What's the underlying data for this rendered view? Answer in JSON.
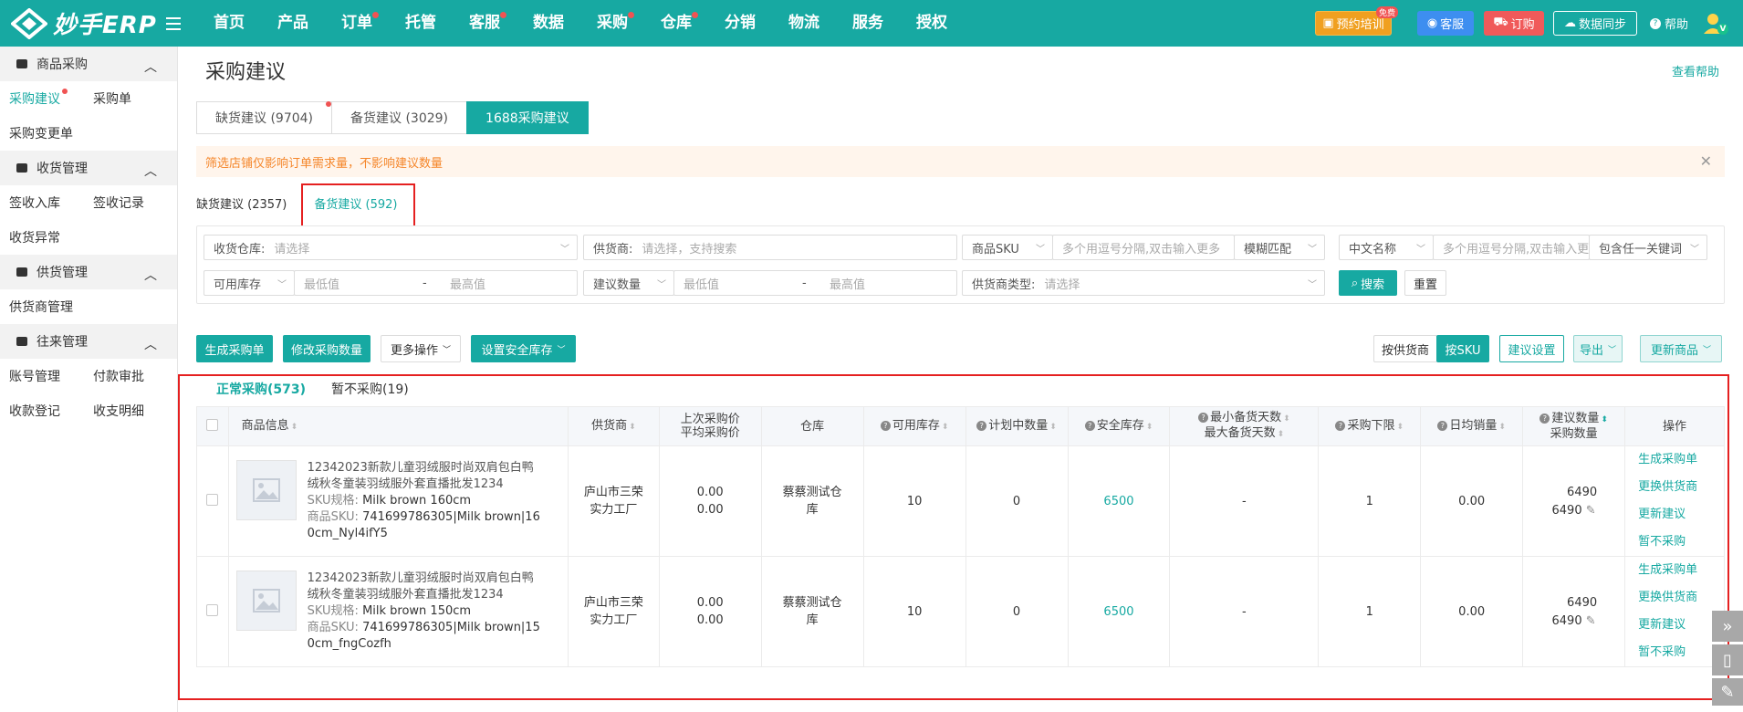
{
  "topbar": {
    "brand": "妙手ERP",
    "nav": [
      {
        "label": "首页",
        "dot": false
      },
      {
        "label": "产品",
        "dot": false
      },
      {
        "label": "订单",
        "dot": true
      },
      {
        "label": "托管",
        "dot": false
      },
      {
        "label": "客服",
        "dot": true
      },
      {
        "label": "数据",
        "dot": false
      },
      {
        "label": "采购",
        "dot": true
      },
      {
        "label": "仓库",
        "dot": true
      },
      {
        "label": "分销",
        "dot": false
      },
      {
        "label": "物流",
        "dot": false
      },
      {
        "label": "服务",
        "dot": false
      },
      {
        "label": "授权",
        "dot": false
      }
    ],
    "training": "预约培训",
    "training_badge": "免费",
    "service": "客服",
    "order": "订购",
    "sync": "数据同步",
    "help": "帮助",
    "avatar_letter": "V"
  },
  "sidebar": {
    "groups": [
      {
        "title": "商品采购",
        "rows": [
          [
            {
              "label": "采购建议",
              "active": true,
              "dot": true
            },
            {
              "label": "采购单"
            }
          ],
          [
            {
              "label": "采购变更单"
            }
          ]
        ]
      },
      {
        "title": "收货管理",
        "rows": [
          [
            {
              "label": "签收入库"
            },
            {
              "label": "签收记录"
            }
          ],
          [
            {
              "label": "收货异常"
            }
          ]
        ]
      },
      {
        "title": "供货管理",
        "rows": [
          [
            {
              "label": "供货商管理"
            }
          ]
        ]
      },
      {
        "title": "往来管理",
        "rows": [
          [
            {
              "label": "账号管理"
            },
            {
              "label": "付款审批"
            }
          ],
          [
            {
              "label": "收款登记"
            },
            {
              "label": "收支明细"
            }
          ]
        ]
      }
    ]
  },
  "page": {
    "title": "采购建议",
    "help_link": "查看帮助",
    "tabs": [
      "缺货建议 (9704)",
      "备货建议 (3029)",
      "1688采购建议"
    ],
    "notice": "筛选店铺仅影响订单需求量，不影响建议数量",
    "subtabs": [
      "缺货建议 (2357)",
      "备货建议 (592)"
    ]
  },
  "filters": {
    "warehouse_label": "收货仓库:",
    "warehouse_ph": "请选择",
    "supplier_label": "供货商:",
    "supplier_ph": "请选择，支持搜索",
    "sku_label": "商品SKU",
    "sku_ph": "多个用逗号分隔,双击输入更多",
    "match": "模糊匹配",
    "cn_name": "中文名称",
    "cn_ph": "多个用逗号分隔,双击输入更多",
    "kw_match": "包含任一关键词",
    "stock_label": "可用库存",
    "min_ph": "最低值",
    "max_ph": "最高值",
    "dash": "-",
    "qty_label": "建议数量",
    "min_ph2": "最低值",
    "max_ph2": "最高值",
    "dash2": "-",
    "stype_label": "供货商类型:",
    "stype_ph": "请选择",
    "search": "搜索",
    "reset": "重置"
  },
  "actions": {
    "create": "生成采购单",
    "modify": "修改采购数量",
    "more": "更多操作",
    "safety": "设置安全库存",
    "by_supplier": "按供货商",
    "by_sku": "按SKU",
    "settings": "建议设置",
    "export": "导出",
    "update": "更新商品"
  },
  "list": {
    "tabs": [
      "正常采购(573)",
      "暂不采购(19)"
    ],
    "headers": {
      "product": "商品信息",
      "supplier": "供货商",
      "price1": "上次采购价",
      "price2": "平均采购价",
      "warehouse": "仓库",
      "available": "可用库存",
      "planned": "计划中数量",
      "safety": "安全库存",
      "days1": "最小备货天数",
      "days2": "最大备货天数",
      "lower": "采购下限",
      "daily": "日均销量",
      "qty1": "建议数量",
      "qty2": "采购数量",
      "ops": "操作"
    },
    "rows": [
      {
        "title": "12342023新款儿童羽绒服时尚双肩包白鸭绒秋冬童装羽绒服外套直播批发1234",
        "spec_label": "SKU规格:",
        "spec": "Milk brown 160cm",
        "sku_label": "商品SKU:",
        "sku": "741699786305|Milk brown|160cm_Nyl4ifY5",
        "supplier": "庐山市三荣实力工厂",
        "last_price": "0.00",
        "avg_price": "0.00",
        "warehouse": "蔡蔡测试仓库",
        "available": "10",
        "planned": "0",
        "safety": "6500",
        "days": "-",
        "lower": "1",
        "daily": "0.00",
        "suggest": "6490",
        "purchase": "6490",
        "ops": [
          "生成采购单",
          "更换供货商",
          "更新建议",
          "暂不采购"
        ]
      },
      {
        "title": "12342023新款儿童羽绒服时尚双肩包白鸭绒秋冬童装羽绒服外套直播批发1234",
        "spec_label": "SKU规格:",
        "spec": "Milk brown 150cm",
        "sku_label": "商品SKU:",
        "sku": "741699786305|Milk brown|150cm_fngCozfh",
        "supplier": "庐山市三荣实力工厂",
        "last_price": "0.00",
        "avg_price": "0.00",
        "warehouse": "蔡蔡测试仓库",
        "available": "10",
        "planned": "0",
        "safety": "6500",
        "days": "-",
        "lower": "1",
        "daily": "0.00",
        "suggest": "6490",
        "purchase": "6490",
        "ops": [
          "生成采购单",
          "更换供货商",
          "更新建议",
          "暂不采购"
        ]
      }
    ]
  },
  "colors": {
    "primary": "#17a9a2",
    "danger": "#e52020",
    "notice_bg": "#fff5ec",
    "notice_text": "#f5862a"
  }
}
